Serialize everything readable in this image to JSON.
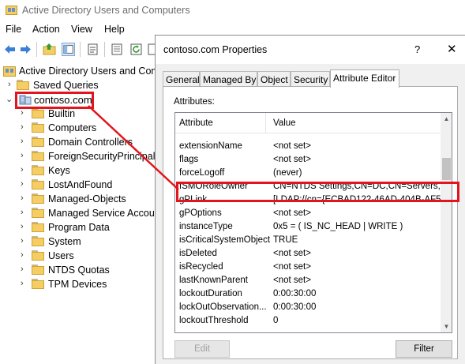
{
  "window": {
    "title": "Active Directory Users and Computers",
    "menu": [
      "File",
      "Action",
      "View",
      "Help"
    ]
  },
  "toolbar": {
    "icons": [
      "back-icon",
      "forward-icon",
      "up-folder-icon",
      "console-tree-icon",
      "properties-icon",
      "export-list-icon",
      "refresh-icon"
    ]
  },
  "tree": {
    "root": "Active Directory Users and Com",
    "saved_queries": "Saved Queries",
    "domain": "contoso.com",
    "children": [
      "Builtin",
      "Computers",
      "Domain Controllers",
      "ForeignSecurityPrincipal",
      "Keys",
      "LostAndFound",
      "Managed-Objects",
      "Managed Service Accour",
      "Program Data",
      "System",
      "Users",
      "NTDS Quotas",
      "TPM Devices"
    ]
  },
  "dialog": {
    "title": "contoso.com Properties",
    "help": "?",
    "close": "✕",
    "tabs": [
      "General",
      "Managed By",
      "Object",
      "Security",
      "Attribute Editor"
    ],
    "active_tab": "Attribute Editor",
    "attributes_label": "Attributes:",
    "columns": [
      "Attribute",
      "Value"
    ],
    "rows": [
      {
        "attribute": "extensionName",
        "value": "<not set>"
      },
      {
        "attribute": "flags",
        "value": "<not set>"
      },
      {
        "attribute": "forceLogoff",
        "value": "(never)"
      },
      {
        "attribute": "fSMORoleOwner",
        "value": "CN=NTDS Settings,CN=DC,CN=Servers,CN"
      },
      {
        "attribute": "gPLink",
        "value": "[LDAP://cn={ECBAD122-46AD-404B-AF51"
      },
      {
        "attribute": "gPOptions",
        "value": "<not set>"
      },
      {
        "attribute": "instanceType",
        "value": "0x5 = ( IS_NC_HEAD | WRITE )"
      },
      {
        "attribute": "isCriticalSystemObject",
        "value": "TRUE"
      },
      {
        "attribute": "isDeleted",
        "value": "<not set>"
      },
      {
        "attribute": "isRecycled",
        "value": "<not set>"
      },
      {
        "attribute": "lastKnownParent",
        "value": "<not set>"
      },
      {
        "attribute": "lockoutDuration",
        "value": "0:00:30:00"
      },
      {
        "attribute": "lockOutObservation...",
        "value": "0:00:30:00"
      },
      {
        "attribute": "lockoutThreshold",
        "value": "0"
      }
    ],
    "edit_button": "Edit",
    "filter_button": "Filter"
  }
}
